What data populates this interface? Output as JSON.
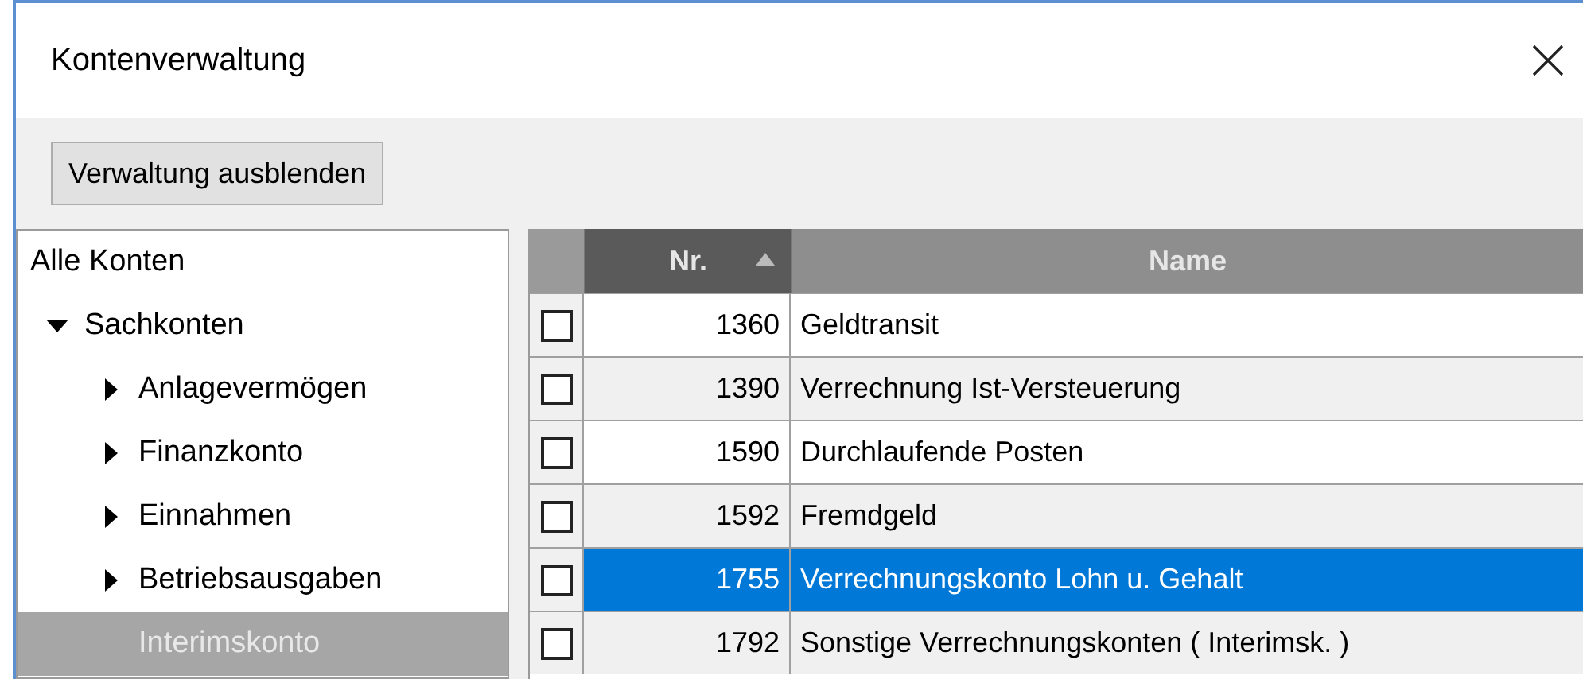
{
  "window": {
    "title": "Kontenverwaltung"
  },
  "toolbar": {
    "button": "Verwaltung ausblenden"
  },
  "tree": [
    {
      "label": "Alle Konten",
      "selected": false,
      "children": [
        {
          "label": "Sachkonten",
          "selected": false,
          "expanded": true,
          "children": [
            {
              "label": "Anlagevermögen",
              "selected": false,
              "expanded": false
            },
            {
              "label": "Finanzkonto",
              "selected": false,
              "expanded": false
            },
            {
              "label": "Einnahmen",
              "selected": false,
              "expanded": false
            },
            {
              "label": "Betriebsausgaben",
              "selected": false,
              "expanded": false
            },
            {
              "label": "Interimskonto",
              "selected": true
            }
          ]
        }
      ]
    }
  ],
  "table": {
    "columns": [
      {
        "label": "Nr.",
        "sorted": true
      },
      {
        "label": "Name",
        "sorted": false
      }
    ],
    "rows": [
      {
        "nr": "1360",
        "name": "Geldtransit",
        "checked": false,
        "selected": false
      },
      {
        "nr": "1390",
        "name": "Verrechnung Ist-Versteuerung",
        "checked": false,
        "selected": false
      },
      {
        "nr": "1590",
        "name": "Durchlaufende Posten",
        "checked": false,
        "selected": false
      },
      {
        "nr": "1592",
        "name": "Fremdgeld",
        "checked": false,
        "selected": false
      },
      {
        "nr": "1755",
        "name": "Verrechnungskonto Lohn u. Gehalt",
        "checked": false,
        "selected": true
      },
      {
        "nr": "1792",
        "name": "Sonstige Verrechnungskonten ( Interimsk. )",
        "checked": false,
        "selected": false
      }
    ]
  }
}
